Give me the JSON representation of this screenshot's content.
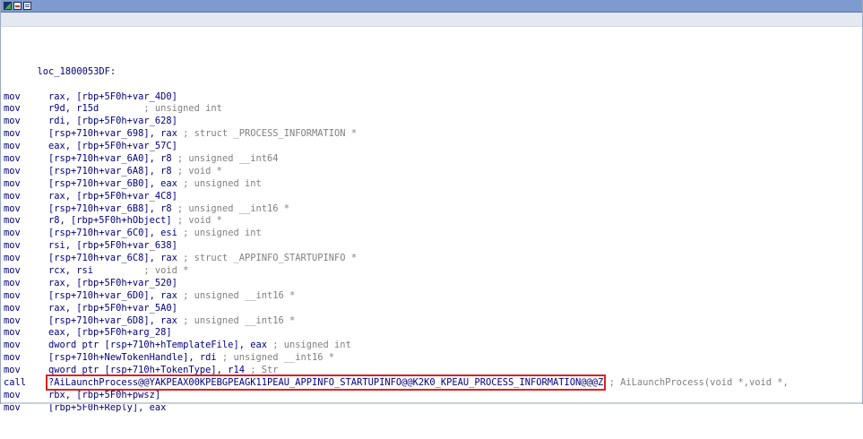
{
  "toolbar": {
    "icons": [
      "ida-graph-icon",
      "breakpoint-icon",
      "text-view-icon"
    ]
  },
  "code": {
    "label": "loc_1800053DF:",
    "lines": [
      {
        "mnem": "mov",
        "ops": "rax, [rbp+5F0h+var_4D0]",
        "comment": ""
      },
      {
        "mnem": "mov",
        "ops": "r9d, r15d",
        "comment": "        ; unsigned int"
      },
      {
        "mnem": "mov",
        "ops": "rdi, [rbp+5F0h+var_628]",
        "comment": ""
      },
      {
        "mnem": "mov",
        "ops": "[rsp+710h+var_698], rax",
        "comment": " ; struct _PROCESS_INFORMATION *"
      },
      {
        "mnem": "mov",
        "ops": "eax, [rbp+5F0h+var_57C]",
        "comment": ""
      },
      {
        "mnem": "mov",
        "ops": "[rsp+710h+var_6A0], r8",
        "comment": " ; unsigned __int64"
      },
      {
        "mnem": "mov",
        "ops": "[rsp+710h+var_6A8], r8",
        "comment": " ; void *"
      },
      {
        "mnem": "mov",
        "ops": "[rsp+710h+var_6B0], eax",
        "comment": " ; unsigned int"
      },
      {
        "mnem": "mov",
        "ops": "rax, [rbp+5F0h+var_4C8]",
        "comment": ""
      },
      {
        "mnem": "mov",
        "ops": "[rsp+710h+var_6B8], r8",
        "comment": " ; unsigned __int16 *"
      },
      {
        "mnem": "mov",
        "ops": "r8, [rbp+5F0h+hObject]",
        "comment": " ; void *"
      },
      {
        "mnem": "mov",
        "ops": "[rsp+710h+var_6C0], esi",
        "comment": " ; unsigned int"
      },
      {
        "mnem": "mov",
        "ops": "rsi, [rbp+5F0h+var_638]",
        "comment": ""
      },
      {
        "mnem": "mov",
        "ops": "[rsp+710h+var_6C8], rax",
        "comment": " ; struct _APPINFO_STARTUPINFO *"
      },
      {
        "mnem": "mov",
        "ops": "rcx, rsi",
        "comment": "         ; void *"
      },
      {
        "mnem": "mov",
        "ops": "rax, [rbp+5F0h+var_520]",
        "comment": ""
      },
      {
        "mnem": "mov",
        "ops": "[rsp+710h+var_6D0], rax",
        "comment": " ; unsigned __int16 *"
      },
      {
        "mnem": "mov",
        "ops": "rax, [rbp+5F0h+var_5A0]",
        "comment": ""
      },
      {
        "mnem": "mov",
        "ops": "[rsp+710h+var_6D8], rax",
        "comment": " ; unsigned __int16 *"
      },
      {
        "mnem": "mov",
        "ops": "eax, [rbp+5F0h+arg_28]",
        "comment": ""
      },
      {
        "mnem": "mov",
        "ops": "dword ptr [rsp+710h+hTemplateFile], eax",
        "comment": " ; unsigned int"
      },
      {
        "mnem": "mov",
        "ops": "[rsp+710h+NewTokenHandle], rdi",
        "comment": " ; unsigned __int16 *"
      },
      {
        "mnem": "mov",
        "ops": "qword ptr [rsp+710h+TokenType], r14",
        "comment": " ; Str"
      },
      {
        "mnem": "call",
        "ops": "?AiLaunchProcess@@YAKPEAX00KPEBGPEAGK11PEAU_APPINFO_STARTUPINFO@@K2K0_KPEAU_PROCESS_INFORMATION@@@Z",
        "comment": " ; AiLaunchProcess(void *,void *,",
        "highlight": true
      },
      {
        "mnem": "mov",
        "ops": "rbx, [rbp+5F0h+pwsz]",
        "comment": ""
      },
      {
        "mnem": "mov",
        "ops": "[rbp+5F0h+Reply], eax",
        "comment": ""
      }
    ]
  }
}
